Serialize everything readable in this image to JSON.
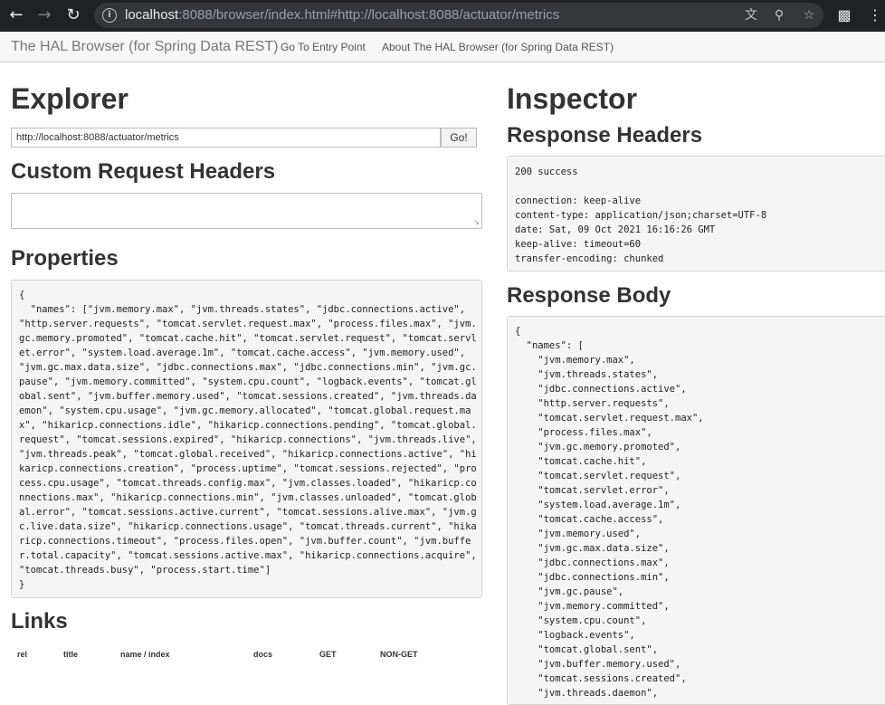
{
  "browser": {
    "url_host": "localhost",
    "url_rest": ":8088/browser/index.html#http://localhost:8088/actuator/metrics"
  },
  "app": {
    "brand": "The HAL Browser (for Spring Data REST)",
    "nav": [
      "Go To Entry Point",
      "About The HAL Browser (for Spring Data REST)"
    ]
  },
  "explorer": {
    "title": "Explorer",
    "url_value": "http://localhost:8088/actuator/metrics",
    "go_label": "Go!",
    "custom_headers_title": "Custom Request Headers",
    "properties_title": "Properties",
    "properties_lines": [
      "{",
      "  \"names\": [\"jvm.memory.max\", \"jvm.threads.states\", \"jdbc.connections.active\",",
      "\"http.server.requests\", \"tomcat.servlet.request.max\", \"process.files.max\", \"jvm.",
      "gc.memory.promoted\", \"tomcat.cache.hit\", \"tomcat.servlet.request\", \"tomcat.servl",
      "et.error\", \"system.load.average.1m\", \"tomcat.cache.access\", \"jvm.memory.used\",",
      "\"jvm.gc.max.data.size\", \"jdbc.connections.max\", \"jdbc.connections.min\", \"jvm.gc.",
      "pause\", \"jvm.memory.committed\", \"system.cpu.count\", \"logback.events\", \"tomcat.gl",
      "obal.sent\", \"jvm.buffer.memory.used\", \"tomcat.sessions.created\", \"jvm.threads.da",
      "emon\", \"system.cpu.usage\", \"jvm.gc.memory.allocated\", \"tomcat.global.request.ma",
      "x\", \"hikaricp.connections.idle\", \"hikaricp.connections.pending\", \"tomcat.global.",
      "request\", \"tomcat.sessions.expired\", \"hikaricp.connections\", \"jvm.threads.live\",",
      "\"jvm.threads.peak\", \"tomcat.global.received\", \"hikaricp.connections.active\", \"hi",
      "karicp.connections.creation\", \"process.uptime\", \"tomcat.sessions.rejected\", \"pro",
      "cess.cpu.usage\", \"tomcat.threads.config.max\", \"jvm.classes.loaded\", \"hikaricp.co",
      "nnections.max\", \"hikaricp.connections.min\", \"jvm.classes.unloaded\", \"tomcat.glob",
      "al.error\", \"tomcat.sessions.active.current\", \"tomcat.sessions.alive.max\", \"jvm.g",
      "c.live.data.size\", \"hikaricp.connections.usage\", \"tomcat.threads.current\", \"hika",
      "ricp.connections.timeout\", \"process.files.open\", \"jvm.buffer.count\", \"jvm.buffe",
      "r.total.capacity\", \"tomcat.sessions.active.max\", \"hikaricp.connections.acquire\",",
      "\"tomcat.threads.busy\", \"process.start.time\"]",
      "}"
    ],
    "links_title": "Links",
    "links_columns": [
      "rel",
      "title",
      "name / index",
      "docs",
      "GET",
      "NON-GET"
    ]
  },
  "inspector": {
    "title": "Inspector",
    "response_headers_title": "Response Headers",
    "response_headers_lines": [
      "200 success",
      "",
      "connection: keep-alive",
      "content-type: application/json;charset=UTF-8",
      "date: Sat, 09 Oct 2021 16:16:26 GMT",
      "keep-alive: timeout=60",
      "transfer-encoding: chunked"
    ],
    "response_body_title": "Response Body",
    "response_body_lines": [
      "{",
      "  \"names\": [",
      "    \"jvm.memory.max\",",
      "    \"jvm.threads.states\",",
      "    \"jdbc.connections.active\",",
      "    \"http.server.requests\",",
      "    \"tomcat.servlet.request.max\",",
      "    \"process.files.max\",",
      "    \"jvm.gc.memory.promoted\",",
      "    \"tomcat.cache.hit\",",
      "    \"tomcat.servlet.request\",",
      "    \"tomcat.servlet.error\",",
      "    \"system.load.average.1m\",",
      "    \"tomcat.cache.access\",",
      "    \"jvm.memory.used\",",
      "    \"jvm.gc.max.data.size\",",
      "    \"jdbc.connections.max\",",
      "    \"jdbc.connections.min\",",
      "    \"jvm.gc.pause\",",
      "    \"jvm.memory.committed\",",
      "    \"system.cpu.count\",",
      "    \"logback.events\",",
      "    \"tomcat.global.sent\",",
      "    \"jvm.buffer.memory.used\",",
      "    \"tomcat.sessions.created\",",
      "    \"jvm.threads.daemon\","
    ]
  }
}
